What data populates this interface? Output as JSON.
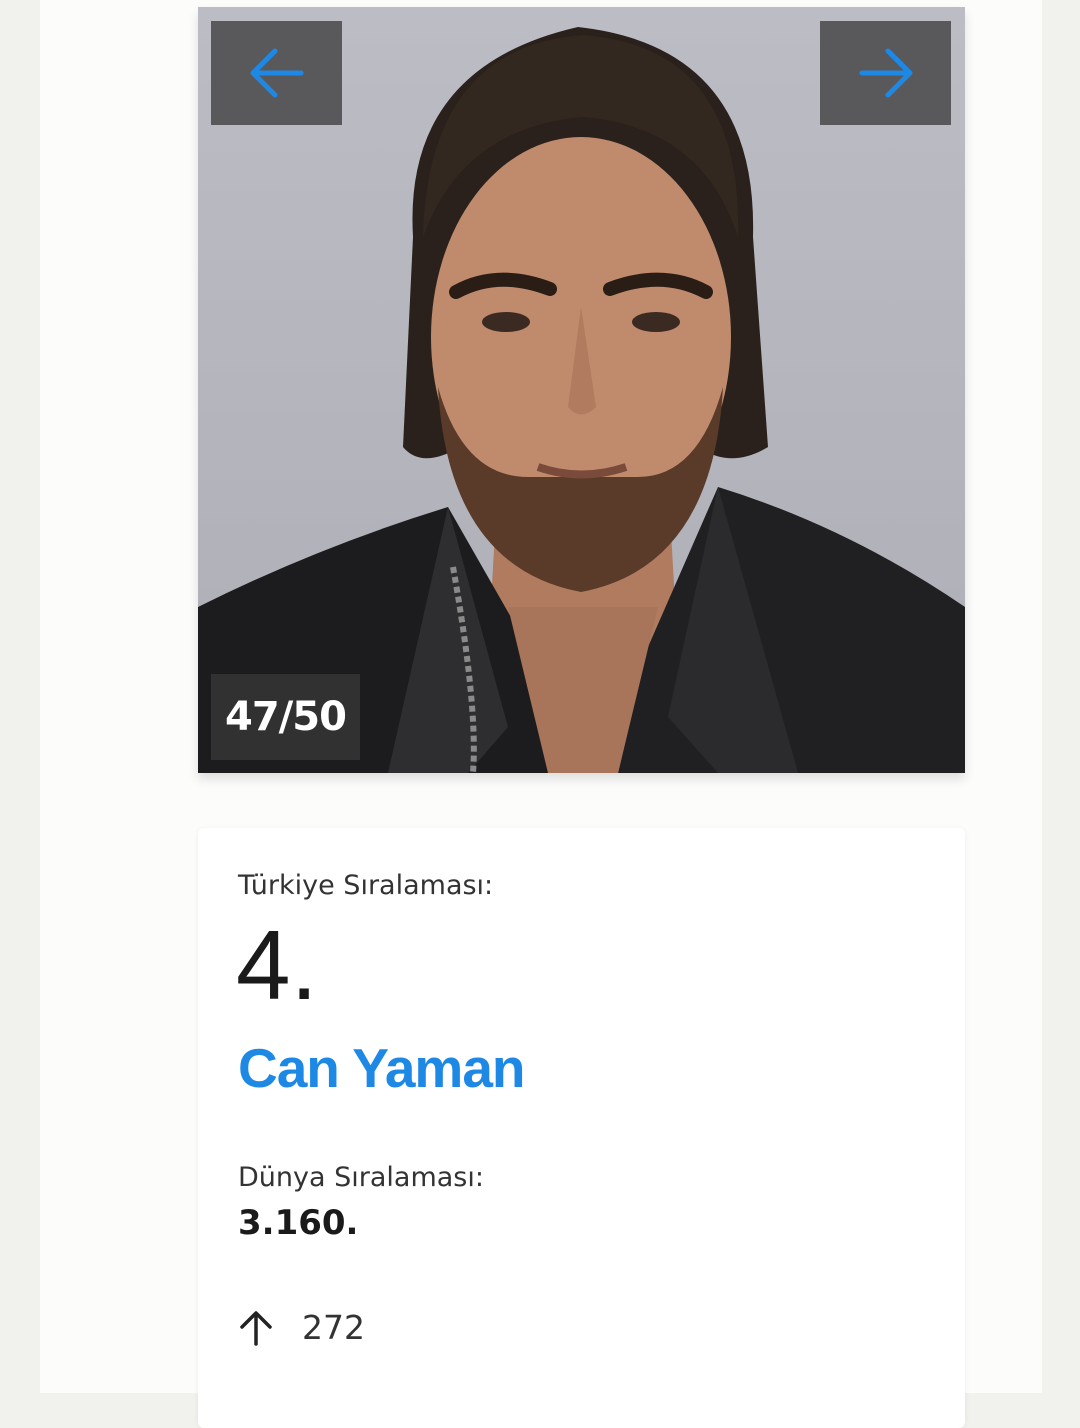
{
  "gallery": {
    "counter": "47/50",
    "prev_icon": "arrow-left-icon",
    "next_icon": "arrow-right-icon",
    "arrow_color": "#1e88e5"
  },
  "ranking": {
    "turkey_label": "Türkiye Sıralaması:",
    "turkey_rank": "4.",
    "name": "Can Yaman",
    "world_label": "Dünya Sıralaması:",
    "world_rank": "3.160.",
    "change_icon": "arrow-up-icon",
    "change_value": "272"
  },
  "colors": {
    "accent": "#1e88e5",
    "page_background": "#f1f1ed"
  }
}
